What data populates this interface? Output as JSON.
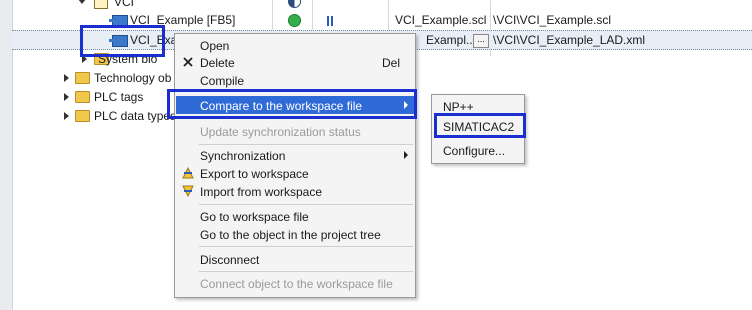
{
  "tree": {
    "rows": [
      {
        "label": "VCI"
      },
      {
        "label": "VCI_Example [FB5]",
        "file": "VCI_Example.scl",
        "path": "\\VCI\\VCI_Example.scl"
      },
      {
        "label": "VCI_Exa",
        "file": "Exampl...",
        "button": "...",
        "path": "\\VCI\\VCI_Example_LAD.xml"
      },
      {
        "label": "System blo"
      },
      {
        "label": "Technology ob"
      },
      {
        "label": "PLC tags"
      },
      {
        "label": "PLC data types"
      }
    ]
  },
  "context_menu": {
    "items": {
      "open": "Open",
      "delete": "Delete",
      "delete_shortcut": "Del",
      "compile": "Compile",
      "compare": "Compare to the workspace file",
      "update_sync": "Update synchronization status",
      "synchronization": "Synchronization",
      "export": "Export to workspace",
      "import": "Import from workspace",
      "goto_file": "Go to workspace file",
      "goto_object": "Go to the object in the project tree",
      "disconnect": "Disconnect",
      "connect": "Connect object to the workspace file"
    }
  },
  "submenu": {
    "items": [
      "NP++",
      "SIMATICAC2",
      "Configure..."
    ]
  },
  "colors": {
    "selection": "#2f6bd6",
    "highlight_box": "#1b2fd1",
    "folder": "#f1c84b",
    "status_ok": "#34b04a"
  }
}
